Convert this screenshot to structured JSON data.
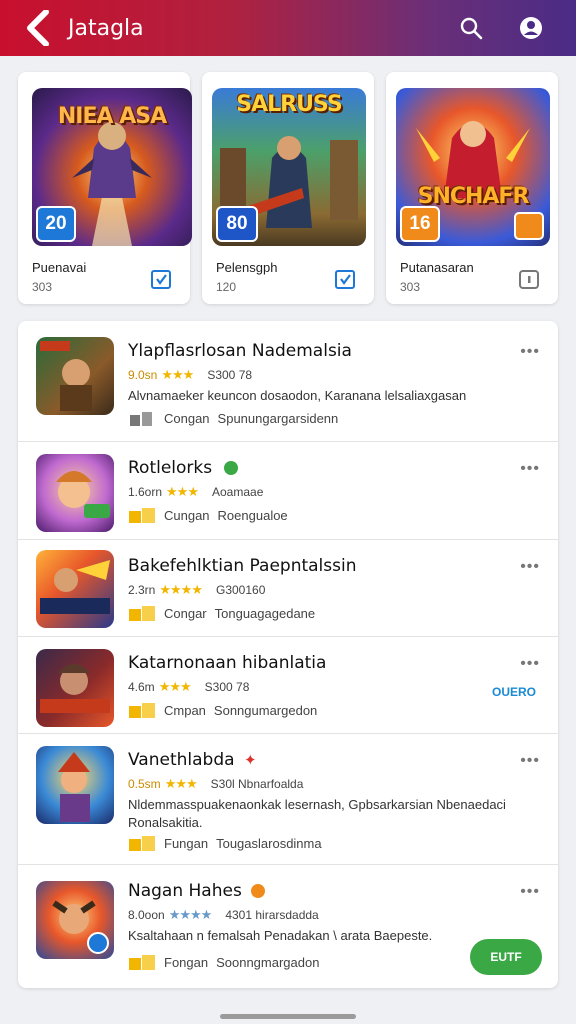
{
  "app": {
    "title": "Jatagla"
  },
  "featured": [
    {
      "art_title": "NIEA ASA",
      "badge": "20",
      "name": "Puenavai",
      "count": "303"
    },
    {
      "art_title": "SALRUSS",
      "badge": "80",
      "name": "Pelensgph",
      "count": "120"
    },
    {
      "art_title": "SNCHAFR",
      "badge": "16",
      "name": "Putanasaran",
      "count": "303"
    }
  ],
  "apps": [
    {
      "title": "Ylapflasrlosan Nademalsia",
      "rating": "9.0sn",
      "stars": "★★★",
      "meta": "S300 78",
      "desc": "Alvnamaeker keuncon dosaodon, Karanana lelsaliaxgasan",
      "tag_label": "Congan",
      "tag_text": "Spunungargarsidenn"
    },
    {
      "title": "Rotlelorks",
      "rating": "1.6orn",
      "stars": "★★★",
      "meta": "Aoamaae",
      "tag_label": "Cungan",
      "tag_text": "Roengualoe"
    },
    {
      "title": "Bakefehlktian Paepntalssin",
      "rating": "2.3rn",
      "stars": "★★★★",
      "meta": "G300160",
      "tag_label": "Congar",
      "tag_text": "Tonguagagedane"
    },
    {
      "title": "Katarnonaan hibanlatia",
      "rating": "4.6m",
      "stars": "★★★",
      "meta": "S300 78",
      "tag_label": "Cmpan",
      "tag_text": "Sonngumargedon",
      "action": "OUERO"
    },
    {
      "title": "Vanethlabda",
      "rating": "0.5sm",
      "stars": "★★★",
      "meta": "S30l Nbnarfoalda",
      "desc": "Nldemmasspuakenaonkak lesernash, Gpbsarkarsian Nbenaedaci Ronalsakitia.",
      "tag_label": "Fungan",
      "tag_text": "Tougaslarosdinma"
    },
    {
      "title": "Nagan Hahes",
      "rating": "8.0oon",
      "stars": "★★★★",
      "meta": "4301 hirarsdadda",
      "desc": "Ksaltahaan n femalsah Penadakan \\ arata Baepeste.",
      "tag_label": "Fongan",
      "tag_text": "Soonngmargadon",
      "action": "EUTF"
    }
  ],
  "colors": {
    "appbar_start": "#c8102e",
    "appbar_end": "#4a2c86",
    "install_green": "#3aa945",
    "star": "#f2b600"
  },
  "icons": [
    "back-arrow-icon",
    "search-icon",
    "account-icon",
    "verified-check-icon",
    "more-dots-icon",
    "gold-tag-icon"
  ]
}
